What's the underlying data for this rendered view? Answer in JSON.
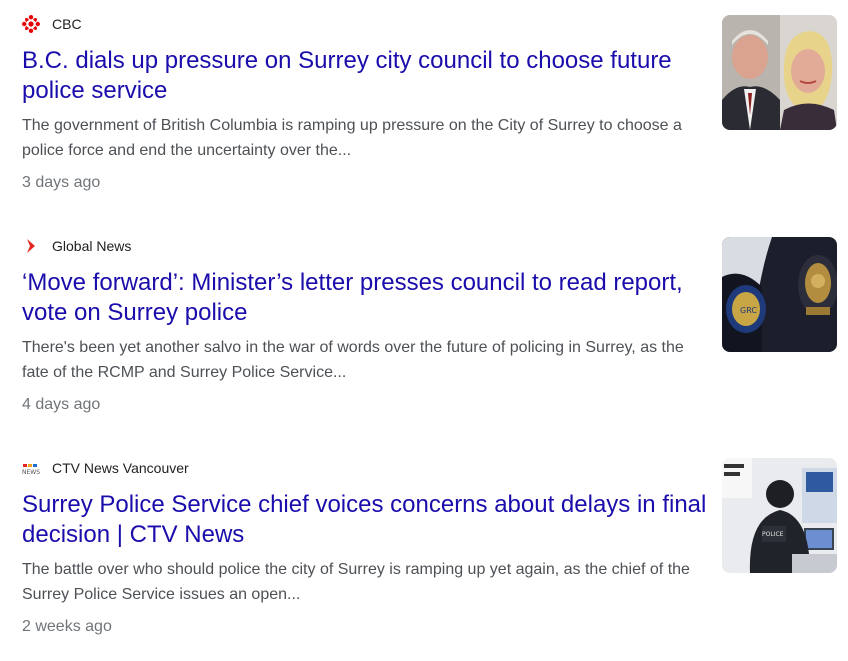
{
  "articles": [
    {
      "source": "CBC",
      "source_icon": "cbc-gem-icon",
      "title": "B.C. dials up pressure on Surrey city council to choose future police service",
      "snippet": "The government of British Columbia is ramping up pressure on the City of Surrey to choose a police force and end the uncertainty over the...",
      "age": "3 days ago",
      "thumbnail": "politicians-photo"
    },
    {
      "source": "Global News",
      "source_icon": "global-news-chevron-icon",
      "title": "‘Move forward’: Minister’s letter presses council to read report, vote on Surrey police",
      "snippet": "There's been yet another salvo in the war of words over the future of policing in Surrey, as the fate of the RCMP and Surrey Police Service...",
      "age": "4 days ago",
      "thumbnail": "police-badges-photo"
    },
    {
      "source": "CTV News Vancouver",
      "source_icon": "ctv-news-icon",
      "title": "Surrey Police Service chief voices concerns about delays in final decision | CTV News",
      "snippet": "The battle over who should police the city of Surrey is ramping up yet again, as the chief of the Surrey Police Service issues an open...",
      "age": "2 weeks ago",
      "thumbnail": "police-officer-photo"
    }
  ],
  "colors": {
    "title_link": "#1a0dab",
    "snippet": "#4d5156",
    "age": "#70757a",
    "cbc_red": "#e60505",
    "global_red": "#e3261f"
  }
}
